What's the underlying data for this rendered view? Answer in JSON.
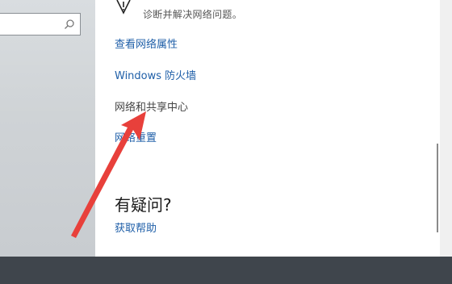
{
  "search": {
    "placeholder": ""
  },
  "warning": {
    "text": "诊断并解决网络问题。"
  },
  "links": {
    "view_properties": "查看网络属性",
    "firewall": "Windows 防火墙",
    "sharing_center": "网络和共享中心",
    "reset": "网络重置"
  },
  "help": {
    "heading": "有疑问?",
    "get_help": "获取帮助"
  },
  "colors": {
    "link": "#1f5fa8",
    "arrow": "#e8403b"
  }
}
